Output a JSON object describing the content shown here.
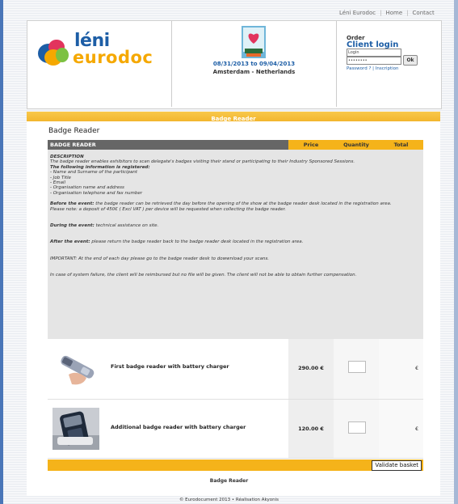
{
  "top_links": {
    "link1": "Léni Eurodoc",
    "link2": "Home",
    "link3": "Contact"
  },
  "logo": {
    "word1": "léni",
    "word2": "eurodoc"
  },
  "event": {
    "dates": "08/31/2013 to 09/04/2013",
    "location": "Amsterdam - Netherlands"
  },
  "login": {
    "order_label": "Order",
    "title": "Client login",
    "login_placeholder": "Login",
    "password_value": "••••••••",
    "ok_label": "Ok",
    "password_link": "Password ?",
    "inscription_link": "Inscription"
  },
  "yellow_bar_title": "Badge Reader",
  "page_title": "Badge Reader",
  "table": {
    "headers": {
      "item": "BADGE READER",
      "price": "Price",
      "quantity": "Quantity",
      "total": "Total"
    }
  },
  "description": {
    "heading": "DESCRIPTION",
    "intro": "The badge reader enables exhibitors to scan delegate's badges visiting their stand or participating to their Industry Sponsored Sessions.",
    "info_heading": "The following information is registered:",
    "info_items": [
      "- Name and Surname of the participant",
      "- Job Title",
      "- Email",
      "- Organisation name and address",
      "- Organisation telephone and fax number"
    ],
    "before_label": "Before the event:",
    "before_text": "the badge reader can be retrieved the day before the opening of the show at the badge reader desk located in the registration area.",
    "deposit_note": "Please note: a deposit of 450€ ( Excl VAT ) per device will be requested when collecting the badge reader.",
    "during_label": "During the event:",
    "during_text": "technical assistance on site.",
    "after_label": "After the event:",
    "after_text": "please return the badge reader back to the badge reader desk located in the registration area.",
    "important_text": "IMPORTANT: At the end of each day please go to the badge reader desk to dowwnload your scans.",
    "failure_text": "In case of system failure, the client will be reimbursed but no file will be given. The client will not be able to obtain further compensation."
  },
  "products": [
    {
      "name": "First badge reader with battery charger",
      "price": "290.00 €",
      "total": "€"
    },
    {
      "name": "Additional badge reader with battery charger",
      "price": "120.00 €",
      "total": "€"
    }
  ],
  "validate_label": "Validate basket",
  "bottom_label": "Badge Reader",
  "footer_text": "© Eurodocument 2013  •  Réalisation Akyonis",
  "colors": {
    "accent_yellow": "#f5b31a",
    "brand_blue": "#1d5ea6",
    "brand_orange": "#f5a800",
    "header_gray": "#666666"
  }
}
